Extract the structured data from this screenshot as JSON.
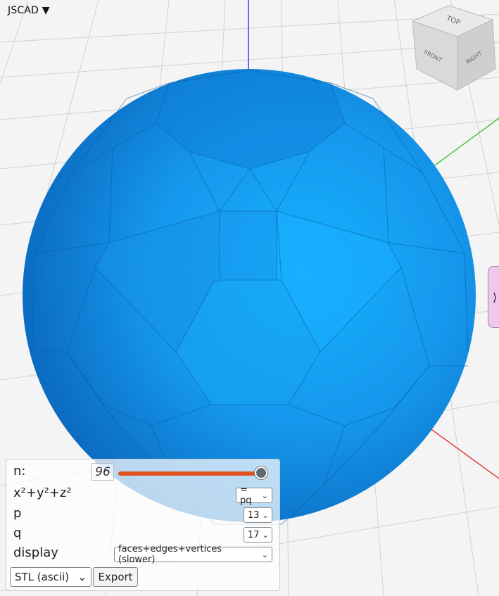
{
  "app": {
    "menu_label": "JSCAD ▼"
  },
  "viewcube": {
    "top": "TOP",
    "front": "FRONT",
    "right": "RIGHT"
  },
  "side_tab": {
    "label": "⟩"
  },
  "params": {
    "n_label": "n:",
    "n_value": "96",
    "n_fraction": 0.95,
    "eq_label": "x²+y²+z²",
    "eq_value": "= pq",
    "p_label": "p",
    "p_value": "13",
    "q_label": "q",
    "q_value": "17",
    "display_label": "display",
    "display_value": "faces+edges+vertices (slower)"
  },
  "export": {
    "format_value": "STL (ascii)",
    "button_label": "Export"
  },
  "colors": {
    "solid_blue": "#1a8fe3",
    "accent_slider": "#e0531f",
    "axis_x": "#e01010",
    "axis_y": "#10c010",
    "axis_z": "#1010e0"
  }
}
